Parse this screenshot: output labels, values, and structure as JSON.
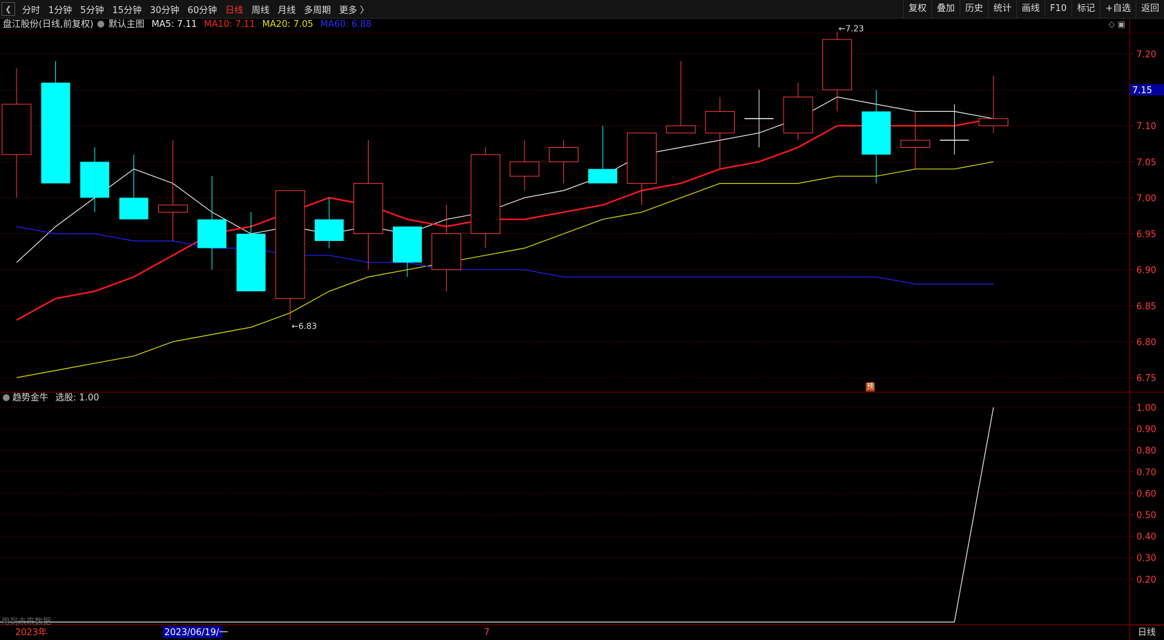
{
  "toolbar": {
    "back_icon": "back-icon",
    "periods": [
      "分时",
      "1分钟",
      "5分钟",
      "15分钟",
      "30分钟",
      "60分钟",
      "日线",
      "周线",
      "月线",
      "多周期",
      "更多 〉"
    ],
    "active_period": "日线",
    "right_buttons": [
      "复权",
      "叠加",
      "历史",
      "统计",
      "画线",
      "F10",
      "标记",
      "+自选",
      "返回"
    ]
  },
  "main_legend": {
    "stock": "盘江股份",
    "mode": "(日线,前复权)",
    "template": "默认主图",
    "ma5": "MA5: 7.11",
    "ma10": "MA10: 7.11",
    "ma20": "MA20: 7.05",
    "ma60": "MA60: 6.88"
  },
  "indicator_legend": {
    "name": "趋势金牛",
    "value": "选股: 1.00"
  },
  "colors": {
    "up": "#ff3b3b",
    "down": "#00ffff",
    "ma5": "#e8e8e8",
    "ma10": "#ff1a1a",
    "ma20": "#e0e000",
    "ma60": "#2020ff",
    "grid": "#8b0000",
    "axis_text": "#ff3b3b",
    "current_price_bg": "#0000a0"
  },
  "main_axis": {
    "min": 6.75,
    "max": 7.2,
    "ticks": [
      "7.20",
      "7.15",
      "7.10",
      "7.05",
      "7.00",
      "6.95",
      "6.90",
      "6.85",
      "6.80",
      "6.75"
    ],
    "current_price": "7.15"
  },
  "ind_axis": {
    "ticks": [
      "1.00",
      "0.90",
      "0.80",
      "0.70",
      "0.60",
      "0.50",
      "0.40",
      "0.30",
      "0.20"
    ]
  },
  "markers": {
    "high": "7.23",
    "low": "6.83",
    "yu": "预"
  },
  "time_axis": {
    "year": "2023年",
    "cursor_date": "2023/06/19/一",
    "mark7": "7"
  },
  "future_note": "用到未来数据",
  "period_box": "日线",
  "chart_data": [
    {
      "type": "candlestick",
      "title": "盘江股份 (日线,前复权)",
      "ylim": [
        6.75,
        7.2
      ],
      "candles": [
        {
          "o": 7.06,
          "h": 7.18,
          "l": 7.0,
          "c": 7.13
        },
        {
          "o": 7.16,
          "h": 7.19,
          "l": 7.02,
          "c": 7.02
        },
        {
          "o": 7.05,
          "h": 7.07,
          "l": 6.98,
          "c": 7.0
        },
        {
          "o": 7.0,
          "h": 7.06,
          "l": 6.97,
          "c": 6.97
        },
        {
          "o": 6.98,
          "h": 7.08,
          "l": 6.94,
          "c": 6.99
        },
        {
          "o": 6.97,
          "h": 7.03,
          "l": 6.9,
          "c": 6.93
        },
        {
          "o": 6.95,
          "h": 6.98,
          "l": 6.87,
          "c": 6.87
        },
        {
          "o": 6.86,
          "h": 7.01,
          "l": 6.83,
          "c": 7.01
        },
        {
          "o": 6.97,
          "h": 7.0,
          "l": 6.93,
          "c": 6.94
        },
        {
          "o": 6.95,
          "h": 7.08,
          "l": 6.9,
          "c": 7.02
        },
        {
          "o": 6.96,
          "h": 6.96,
          "l": 6.89,
          "c": 6.91
        },
        {
          "o": 6.9,
          "h": 6.99,
          "l": 6.87,
          "c": 6.95
        },
        {
          "o": 6.95,
          "h": 7.07,
          "l": 6.93,
          "c": 7.06
        },
        {
          "o": 7.03,
          "h": 7.08,
          "l": 7.01,
          "c": 7.05
        },
        {
          "o": 7.05,
          "h": 7.08,
          "l": 7.02,
          "c": 7.07
        },
        {
          "o": 7.04,
          "h": 7.1,
          "l": 7.02,
          "c": 7.02
        },
        {
          "o": 7.02,
          "h": 7.09,
          "l": 6.99,
          "c": 7.09
        },
        {
          "o": 7.09,
          "h": 7.19,
          "l": 7.09,
          "c": 7.1
        },
        {
          "o": 7.09,
          "h": 7.14,
          "l": 7.04,
          "c": 7.12
        },
        {
          "o": 7.11,
          "h": 7.15,
          "l": 7.07,
          "c": 7.11
        },
        {
          "o": 7.09,
          "h": 7.16,
          "l": 7.08,
          "c": 7.14
        },
        {
          "o": 7.15,
          "h": 7.23,
          "l": 7.12,
          "c": 7.22
        },
        {
          "o": 7.12,
          "h": 7.15,
          "l": 7.02,
          "c": 7.06
        },
        {
          "o": 7.07,
          "h": 7.12,
          "l": 7.04,
          "c": 7.08
        },
        {
          "o": 7.08,
          "h": 7.13,
          "l": 7.06,
          "c": 7.08
        },
        {
          "o": 7.1,
          "h": 7.17,
          "l": 7.09,
          "c": 7.11
        }
      ],
      "series": [
        {
          "name": "MA5",
          "values": [
            6.91,
            6.96,
            7.0,
            7.04,
            7.02,
            6.98,
            6.95,
            6.96,
            6.95,
            6.96,
            6.95,
            6.97,
            6.98,
            7.0,
            7.01,
            7.03,
            7.06,
            7.07,
            7.08,
            7.09,
            7.11,
            7.14,
            7.13,
            7.12,
            7.12,
            7.11
          ]
        },
        {
          "name": "MA10",
          "values": [
            6.83,
            6.86,
            6.87,
            6.89,
            6.92,
            6.95,
            6.96,
            6.98,
            7.0,
            6.99,
            6.97,
            6.96,
            6.97,
            6.97,
            6.98,
            6.99,
            7.01,
            7.02,
            7.04,
            7.05,
            7.07,
            7.1,
            7.1,
            7.1,
            7.1,
            7.11
          ]
        },
        {
          "name": "MA20",
          "values": [
            6.75,
            6.76,
            6.77,
            6.78,
            6.8,
            6.81,
            6.82,
            6.84,
            6.87,
            6.89,
            6.9,
            6.91,
            6.92,
            6.93,
            6.95,
            6.97,
            6.98,
            7.0,
            7.02,
            7.02,
            7.02,
            7.03,
            7.03,
            7.04,
            7.04,
            7.05
          ]
        },
        {
          "name": "MA60",
          "values": [
            6.96,
            6.95,
            6.95,
            6.94,
            6.94,
            6.93,
            6.93,
            6.92,
            6.92,
            6.91,
            6.91,
            6.9,
            6.9,
            6.9,
            6.89,
            6.89,
            6.89,
            6.89,
            6.89,
            6.89,
            6.89,
            6.89,
            6.89,
            6.88,
            6.88,
            6.88
          ]
        }
      ]
    },
    {
      "type": "line",
      "title": "趋势金牛",
      "ylim": [
        0.0,
        1.0
      ],
      "series": [
        {
          "name": "选股",
          "values": [
            0,
            0,
            0,
            0,
            0,
            0,
            0,
            0,
            0,
            0,
            0,
            0,
            0,
            0,
            0,
            0,
            0,
            0,
            0,
            0,
            0,
            0,
            0,
            0,
            0,
            1
          ]
        }
      ]
    }
  ]
}
